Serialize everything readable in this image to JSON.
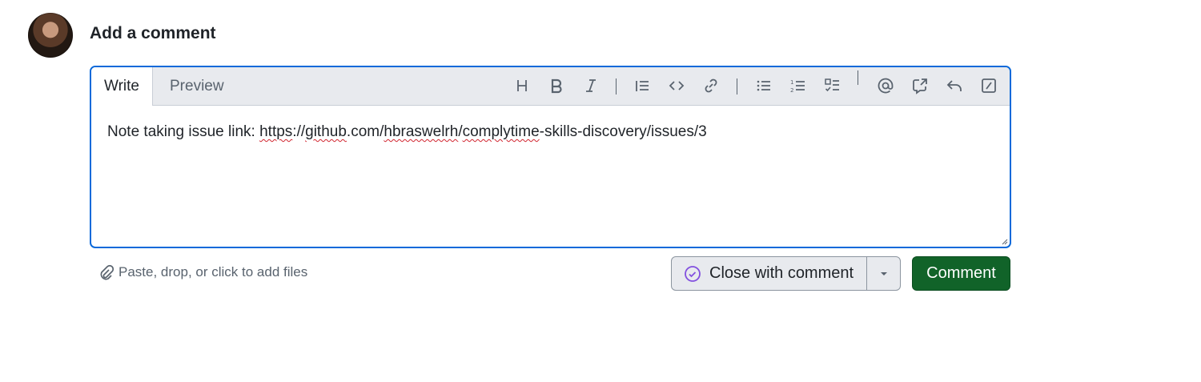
{
  "header": {
    "title": "Add a comment"
  },
  "editor": {
    "tabs": [
      {
        "label": "Write",
        "active": true
      },
      {
        "label": "Preview",
        "active": false
      }
    ],
    "toolbar_icons": [
      "heading-icon",
      "bold-icon",
      "italic-icon",
      "quote-icon",
      "code-icon",
      "link-icon",
      "bulleted-list-icon",
      "numbered-list-icon",
      "task-list-icon",
      "mention-icon",
      "cross-reference-icon",
      "reply-icon",
      "slash-commands-icon"
    ],
    "text_prefix": "Note taking issue link: ",
    "text_link": {
      "p1": "https",
      "p2": "://",
      "p3": "github",
      "p4": ".com/",
      "p5": "hbraswelrh",
      "p6": "/",
      "p7": "complytime",
      "p8": "-skills-discovery/issues/3"
    }
  },
  "footer": {
    "attach_label": "Paste, drop, or click to add files",
    "close_label": "Close with comment",
    "comment_label": "Comment"
  },
  "colors": {
    "focus_border": "#0969da",
    "primary_button": "#116329",
    "close_icon": "#8250df"
  }
}
